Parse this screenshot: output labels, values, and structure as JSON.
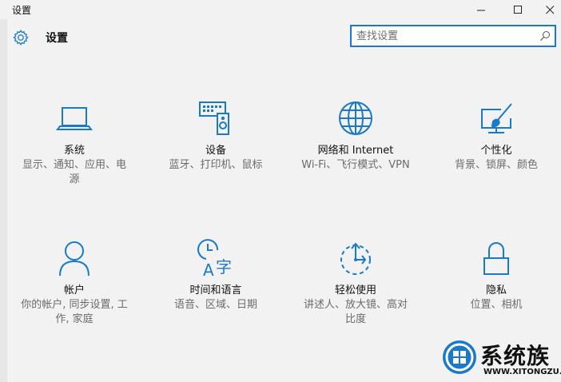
{
  "window": {
    "title": "设置",
    "minimize_glyph": "—",
    "maximize_glyph": "☐",
    "close_glyph": "✕"
  },
  "header": {
    "title": "设置",
    "icon": "gear-icon"
  },
  "search": {
    "placeholder": "查找设置",
    "icon": "search-icon"
  },
  "accent_color": "#1979ca",
  "tiles": [
    {
      "id": "system",
      "title": "系统",
      "desc": "显示、通知、应用、电源",
      "icon": "laptop-icon"
    },
    {
      "id": "devices",
      "title": "设备",
      "desc": "蓝牙、打印机、鼠标",
      "icon": "devices-icon"
    },
    {
      "id": "network",
      "title": "网络和 Internet",
      "desc": "Wi-Fi、飞行模式、VPN",
      "icon": "globe-icon"
    },
    {
      "id": "personalization",
      "title": "个性化",
      "desc": "背景、锁屏、颜色",
      "icon": "personalization-icon"
    },
    {
      "id": "accounts",
      "title": "帐户",
      "desc": "你的帐户, 同步设置, 工作, 家庭",
      "icon": "person-icon"
    },
    {
      "id": "time-language",
      "title": "时间和语言",
      "desc": "语音、区域、日期",
      "icon": "time-language-icon"
    },
    {
      "id": "ease-of-access",
      "title": "轻松使用",
      "desc": "讲述人、放大镜、高对比度",
      "icon": "ease-of-access-icon"
    },
    {
      "id": "privacy",
      "title": "隐私",
      "desc": "位置、相机",
      "icon": "lock-icon"
    }
  ],
  "watermark": {
    "text": "系统族",
    "url": "WWW.XITONGZU.COM"
  }
}
